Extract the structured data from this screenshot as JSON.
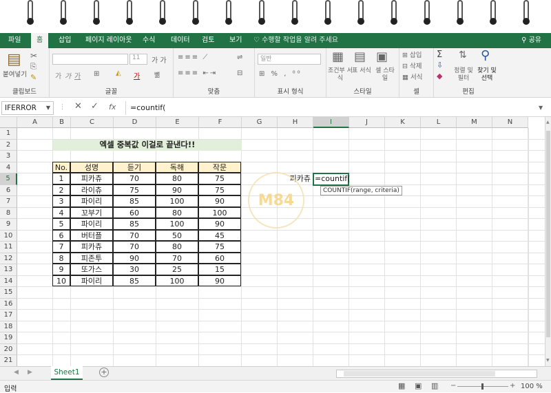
{
  "ribbon_tabs": [
    "파일",
    "홈",
    "삽입",
    "페이지 레이아웃",
    "수식",
    "데이터",
    "검토",
    "보기"
  ],
  "tell_me": "수행할 작업을 알려 주세요",
  "share": "공유",
  "groups": {
    "clipboard": {
      "label": "클립보드",
      "paste": "붙여넣기"
    },
    "font": {
      "label": "글꼴",
      "size": "11",
      "bold": "가",
      "italic": "가",
      "underline": "가"
    },
    "align": {
      "label": "맞춤"
    },
    "number": {
      "label": "표시 형식",
      "format": "일반"
    },
    "styles": {
      "label": "스타일",
      "cond": "조건부 서식",
      "table": "표 서식",
      "cell": "셀 스타일"
    },
    "cells": {
      "label": "셀",
      "insert": "삽입",
      "delete": "삭제",
      "format": "서식"
    },
    "edit": {
      "label": "편집",
      "sort": "정렬 및 필터",
      "find": "찾기 및 선택"
    }
  },
  "name_box": "IFERROR",
  "formula": "=countif(",
  "columns": [
    "A",
    "B",
    "C",
    "D",
    "E",
    "F",
    "G",
    "H",
    "I",
    "J",
    "K",
    "L",
    "M",
    "N"
  ],
  "selected_column": "I",
  "rows": [
    "1",
    "2",
    "3",
    "4",
    "5",
    "6",
    "7",
    "8",
    "9",
    "10",
    "11",
    "12",
    "13",
    "14",
    "15",
    "16",
    "17",
    "18",
    "19",
    "20",
    "21"
  ],
  "selected_row": "5",
  "title": "엑셀 중복값 이걸로 끝낸다!!",
  "table": {
    "headers": [
      "No.",
      "성명",
      "듣기",
      "독해",
      "작문"
    ],
    "rows": [
      [
        "1",
        "피카츄",
        "70",
        "80",
        "75"
      ],
      [
        "2",
        "라이츄",
        "75",
        "90",
        "75"
      ],
      [
        "3",
        "파이리",
        "85",
        "100",
        "90"
      ],
      [
        "4",
        "꼬부기",
        "60",
        "80",
        "100"
      ],
      [
        "5",
        "파이리",
        "85",
        "100",
        "90"
      ],
      [
        "6",
        "버터플",
        "70",
        "50",
        "45"
      ],
      [
        "7",
        "피카츄",
        "70",
        "80",
        "75"
      ],
      [
        "8",
        "피존투",
        "90",
        "70",
        "60"
      ],
      [
        "9",
        "또가스",
        "30",
        "25",
        "15"
      ],
      [
        "10",
        "파이리",
        "85",
        "100",
        "90"
      ]
    ]
  },
  "lookup_label": "피카츄",
  "active_cell_text": "=countif(",
  "tooltip": "COUNTIF(range, criteria)",
  "watermark": "M84",
  "sheet_tab": "Sheet1",
  "status_text": "입력",
  "zoom": "100 %",
  "colors": {
    "accent": "#217346",
    "title_fill": "#e2efda",
    "header_fill": "#fff2cc"
  }
}
